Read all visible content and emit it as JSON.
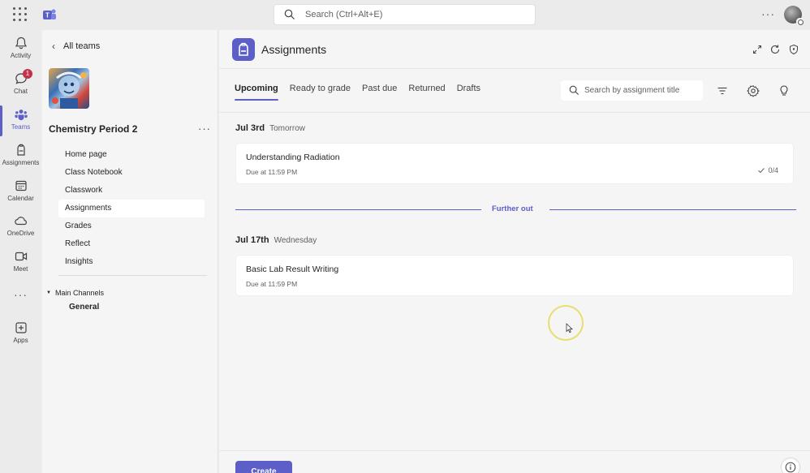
{
  "topbar": {
    "search_placeholder": "Search (Ctrl+Alt+E)",
    "more_label": "···"
  },
  "rail": {
    "items": [
      {
        "label": "Activity",
        "icon": "bell-icon"
      },
      {
        "label": "Chat",
        "icon": "chat-icon",
        "badge": "1"
      },
      {
        "label": "Teams",
        "icon": "teams-icon",
        "active": true
      },
      {
        "label": "Assignments",
        "icon": "assignments-icon"
      },
      {
        "label": "Calendar",
        "icon": "calendar-icon"
      },
      {
        "label": "OneDrive",
        "icon": "cloud-icon"
      },
      {
        "label": "Meet",
        "icon": "video-icon"
      },
      {
        "label": "Apps",
        "icon": "plus-box-icon"
      }
    ],
    "more_label": "···"
  },
  "team_panel": {
    "back_label": "All teams",
    "team_name": "Chemistry Period 2",
    "more_label": "···",
    "nav": [
      "Home page",
      "Class Notebook",
      "Classwork",
      "Assignments",
      "Grades",
      "Reflect",
      "Insights"
    ],
    "active_nav": "Assignments",
    "channels_header": "Main Channels",
    "channels": [
      "General"
    ]
  },
  "main": {
    "app_title": "Assignments",
    "tabs": [
      "Upcoming",
      "Ready to grade",
      "Past due",
      "Returned",
      "Drafts"
    ],
    "active_tab": "Upcoming",
    "search_placeholder": "Search by assignment title",
    "groups": [
      {
        "date": "Jul 3rd",
        "relative": "Tomorrow",
        "assignments": [
          {
            "title": "Understanding Radiation",
            "due": "Due at 11:59 PM",
            "status": "0/4"
          }
        ]
      },
      {
        "date": "Jul 17th",
        "relative": "Wednesday",
        "assignments": [
          {
            "title": "Basic Lab Result Writing",
            "due": "Due at 11:59 PM"
          }
        ]
      }
    ],
    "further_out_label": "Further out",
    "create_label": "Create"
  },
  "colors": {
    "accent": "#5b5fc7",
    "badge": "#c4314b",
    "cursor_highlight": "#e6e06b"
  }
}
